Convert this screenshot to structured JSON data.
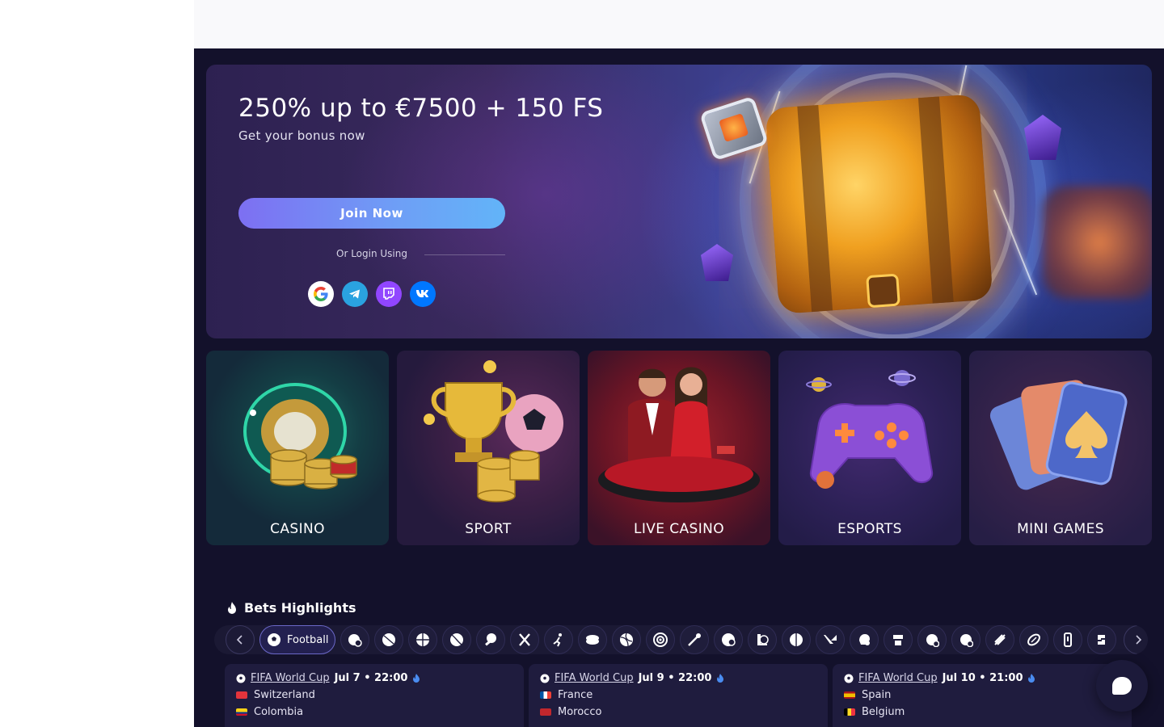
{
  "hero": {
    "title": "250% up to €7500 + 150 FS",
    "subtitle": "Get your bonus now",
    "join_label": "Join Now",
    "login_label": "Or Login Using",
    "socials": [
      "google-icon",
      "telegram-icon",
      "twitch-icon",
      "vk-icon"
    ]
  },
  "categories": [
    {
      "label": "CASINO"
    },
    {
      "label": "SPORT"
    },
    {
      "label": "LIVE CASINO"
    },
    {
      "label": "ESPORTS"
    },
    {
      "label": "MINI GAMES"
    }
  ],
  "highlights": {
    "title": "Bets Highlights",
    "active_sport": "Football",
    "sport_icons": [
      "counter-strike-icon",
      "basketball-icon",
      "basketball-icon",
      "tennis-icon",
      "table-tennis-icon",
      "hockey-icon",
      "cricket-icon",
      "ice-hockey-icon",
      "volleyball-icon",
      "darts-icon",
      "badminton-icon",
      "dota-icon",
      "league-of-legends-icon",
      "mma-icon",
      "valorant-icon",
      "handball-icon",
      "overwatch-icon",
      "fifa-icon",
      "nba2k-icon",
      "rugby-icon",
      "american-football-icon",
      "rainbow-six-icon",
      "starcraft-icon"
    ],
    "matches": [
      {
        "league": "FIFA World Cup",
        "time": "Jul 7 • 22:00",
        "team1": "Switzerland",
        "team2": "Colombia"
      },
      {
        "league": "FIFA World Cup",
        "time": "Jul 9 • 22:00",
        "team1": "France",
        "team2": "Morocco"
      },
      {
        "league": "FIFA World Cup",
        "time": "Jul 10 • 21:00",
        "team1": "Spain",
        "team2": "Belgium"
      }
    ]
  },
  "colors": {
    "background": "#13112b",
    "accent_gradient_start": "#7d6ff2",
    "accent_gradient_end": "#62b4f8"
  }
}
